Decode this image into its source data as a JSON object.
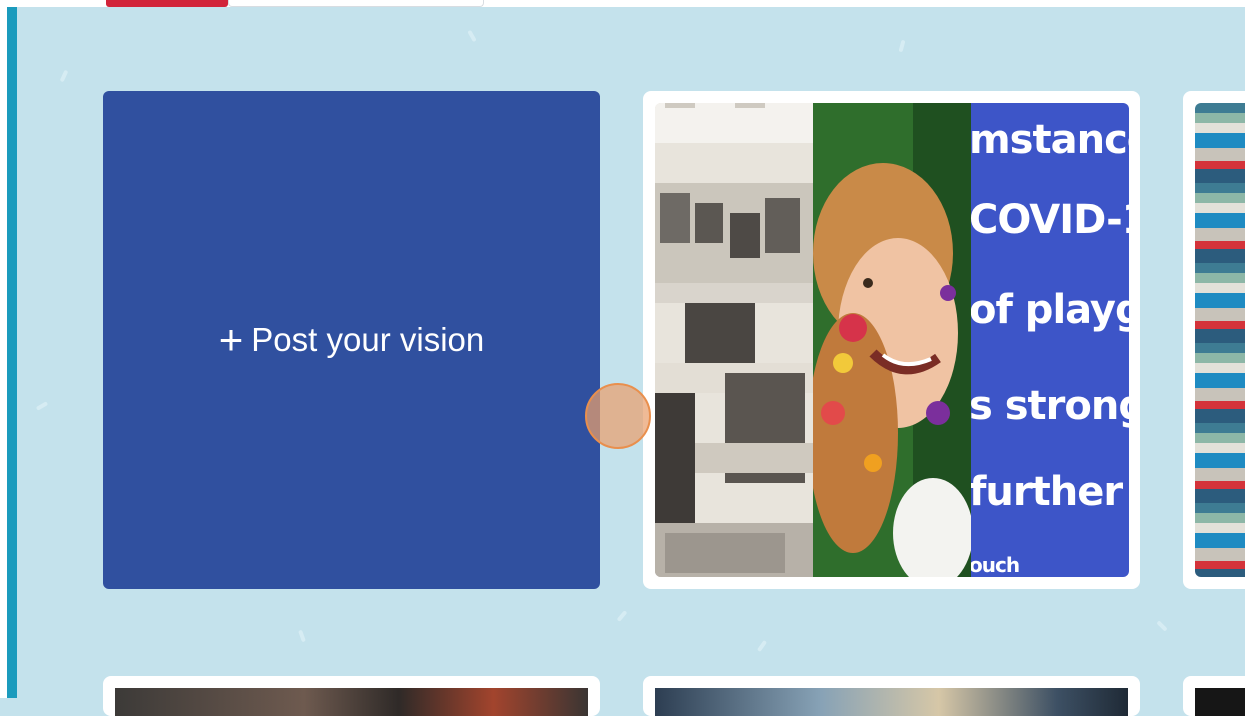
{
  "post_card": {
    "plus": "+",
    "label": "Post your vision"
  },
  "collage_sign": {
    "lines": [
      "mstances",
      "COVID-1",
      "of playgr",
      "s strongly",
      "further r",
      "ouch"
    ]
  },
  "colors": {
    "background": "#c4e2ec",
    "post_card": "#30509f",
    "accent_bar": "#1b9bbd",
    "active_tab": "#d2243a",
    "sign_panel": "#3d55c8"
  }
}
